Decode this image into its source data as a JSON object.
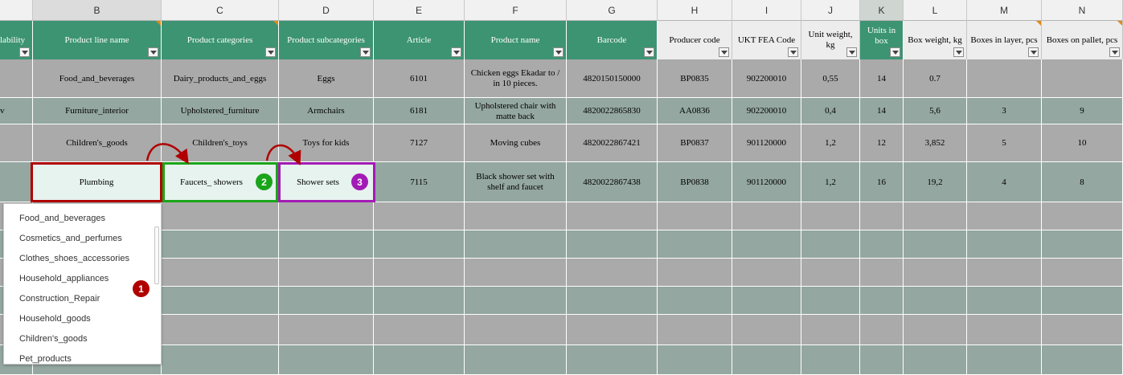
{
  "columns": [
    "B",
    "C",
    "D",
    "E",
    "F",
    "G",
    "H",
    "I",
    "J",
    "K",
    "L",
    "M",
    "N"
  ],
  "headers": {
    "a": "lability",
    "b": "Product line name",
    "c": "Product categories",
    "d": "Product subcategories",
    "e": "Article",
    "f": "Product name",
    "g": "Barcode",
    "h": "Producer code",
    "i": "UKT FEA Code",
    "j": "Unit weight, kg",
    "k": "Units in box",
    "l": "Box weight, kg",
    "m": "Boxes in layer, pcs",
    "n": "Boxes on pallet, pcs"
  },
  "rows": [
    {
      "a": "",
      "b": "Food_and_beverages",
      "c": "Dairy_products_and_eggs",
      "d": "Eggs",
      "e": "6101",
      "f": "Chicken eggs Ekadar to / in 10 pieces.",
      "g": "4820150150000",
      "h": "BP0835",
      "i": "902200010",
      "j": "0,55",
      "k": "14",
      "l": "0.7",
      "m": "",
      "n": ""
    },
    {
      "a": "v",
      "b": "Furniture_interior",
      "c": "Upholstered_furniture",
      "d": "Armchairs",
      "e": "6181",
      "f": "Upholstered chair with matte back",
      "g": "4820022865830",
      "h": "AA0836",
      "i": "902200010",
      "j": "0,4",
      "k": "14",
      "l": "5,6",
      "m": "3",
      "n": "9"
    },
    {
      "a": "",
      "b": "Children's_goods",
      "c": "Children's_toys",
      "d": "Toys for kids",
      "e": "7127",
      "f": "Moving cubes",
      "g": "4820022867421",
      "h": "BP0837",
      "i": "901120000",
      "j": "1,2",
      "k": "12",
      "l": "3,852",
      "m": "5",
      "n": "10"
    },
    {
      "a": "",
      "b": "Plumbing",
      "c": "Faucets_ showers",
      "d": "Shower sets",
      "e": "7115",
      "f": "Black shower set with shelf and faucet",
      "g": "4820022867438",
      "h": "BP0838",
      "i": "901120000",
      "j": "1,2",
      "k": "16",
      "l": "19,2",
      "m": "4",
      "n": "8"
    }
  ],
  "badges": [
    "1",
    "2",
    "3"
  ],
  "dropdown": {
    "items": [
      "Food_and_beverages",
      "Cosmetics_and_perfumes",
      "Clothes_shoes_accessories",
      "Household_appliances",
      "Construction_Repair",
      "Household_goods",
      "Children's_goods",
      "Pet_products"
    ]
  },
  "colors": {
    "header_green": "#3c9472",
    "row_gray": "#a9aaa9",
    "row_teal": "#94a7a0",
    "badge1": "#b00000",
    "badge2": "#19a519",
    "badge3": "#a31bb5"
  }
}
